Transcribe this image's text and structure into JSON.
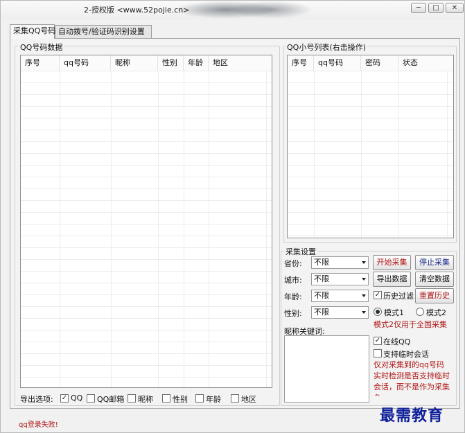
{
  "window": {
    "title": "2-授权版 <www.52pojie.cn>",
    "controls": {
      "minimize": "─",
      "maximize": "□",
      "close": "✕"
    }
  },
  "tabs": [
    {
      "label": "采集QQ号码",
      "active": true
    },
    {
      "label": "自动拨号/验证码识别设置",
      "active": false
    }
  ],
  "qq_data": {
    "group_label": "QQ号码数据",
    "columns": [
      "序号",
      "qq号码",
      "昵称",
      "性别",
      "年龄",
      "地区"
    ]
  },
  "small_accounts": {
    "group_label": "QQ小号列表(右击操作)",
    "columns": [
      "序号",
      "qq号码",
      "密码",
      "状态"
    ]
  },
  "settings": {
    "group_label": "采集设置",
    "province_label": "省份:",
    "province_value": "不限",
    "city_label": "城市:",
    "city_value": "不限",
    "age_label": "年龄:",
    "age_value": "不限",
    "gender_label": "性别:",
    "gender_value": "不限",
    "start_button": "开始采集",
    "stop_button": "停止采集",
    "export_button": "导出数据",
    "clear_button": "清空数据",
    "history_filter_label": "历史过滤",
    "reset_history_button": "重置历史",
    "mode1_label": "模式1",
    "mode2_label": "模式2",
    "mode_note": "模式2仅用于全国采集",
    "nickname_keyword_label": "昵称关键词:",
    "online_qq_label": "在线QQ",
    "temp_chat_label": "支持临时会话",
    "temp_chat_note": "仅对采集到的qq号码实时检测是否支持临时会话，而不是作为采集条"
  },
  "export_options": {
    "label": "导出选项:",
    "options": [
      {
        "label": "QQ",
        "checked": true
      },
      {
        "label": "QQ邮箱",
        "checked": false
      },
      {
        "label": "昵称",
        "checked": false
      },
      {
        "label": "性别",
        "checked": false
      },
      {
        "label": "年龄",
        "checked": false
      },
      {
        "label": "地区",
        "checked": false
      }
    ]
  },
  "status": {
    "message": "qq登录失败!"
  },
  "watermark": "最需教育",
  "colors": {
    "accent_red": "#b01818",
    "watermark_blue": "#10209a"
  }
}
